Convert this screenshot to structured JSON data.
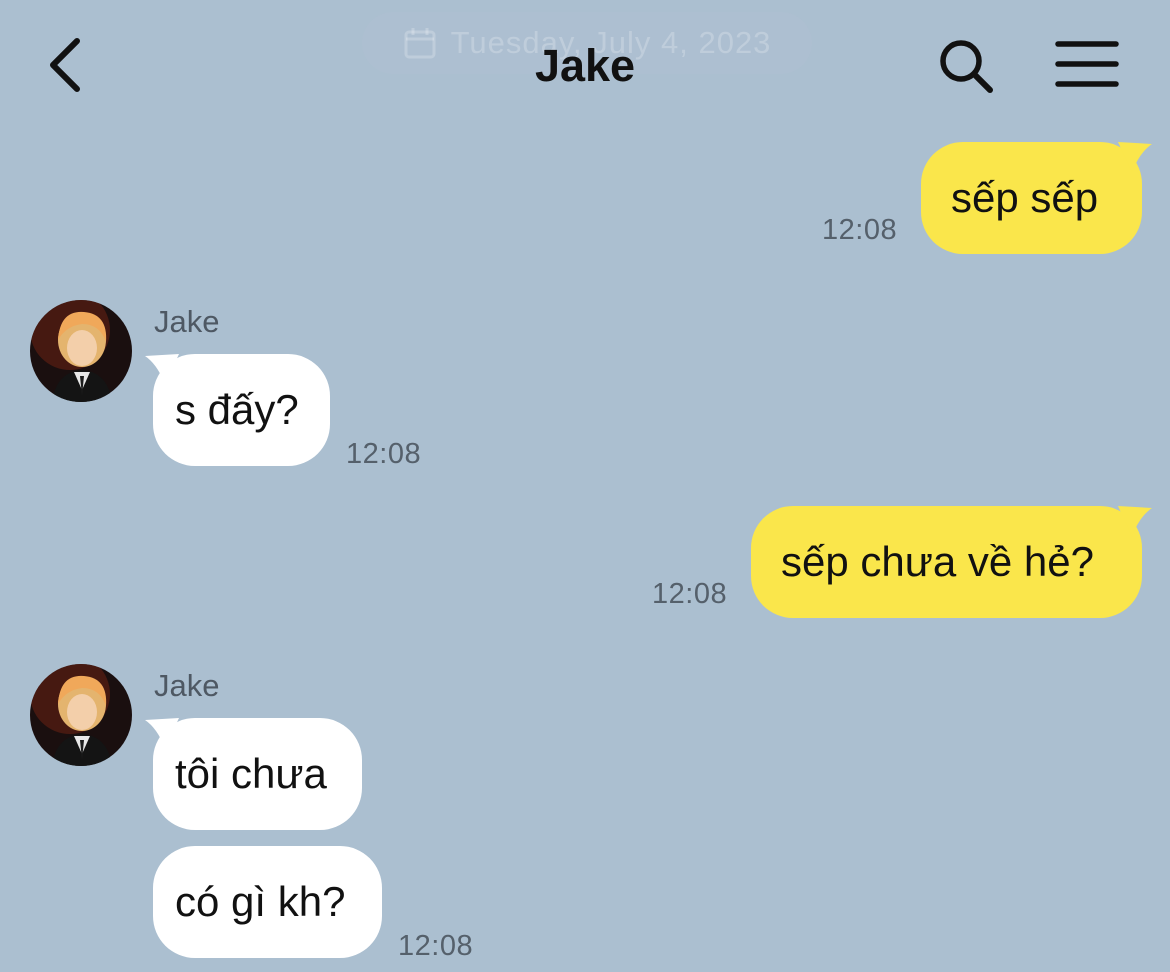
{
  "header": {
    "title": "Jake",
    "date_label": "Tuesday, July 4, 2023",
    "back_icon": "chevron-left-icon",
    "search_icon": "search-icon",
    "menu_icon": "hamburger-menu-icon"
  },
  "colors": {
    "background": "#abbfd0",
    "my_bubble": "#fae64b",
    "their_bubble": "#ffffff"
  },
  "messages": [
    {
      "from": "me",
      "text": "sếp sếp",
      "time": "12:08"
    },
    {
      "from": "Jake",
      "sender_label": "Jake",
      "text": "s đấy?",
      "time": "12:08"
    },
    {
      "from": "me",
      "text": "sếp chưa về hẻ?",
      "time": "12:08"
    },
    {
      "from": "Jake",
      "sender_label": "Jake",
      "text": "tôi chưa"
    },
    {
      "from": "Jake",
      "text": "có gì kh?",
      "time": "12:08"
    }
  ]
}
